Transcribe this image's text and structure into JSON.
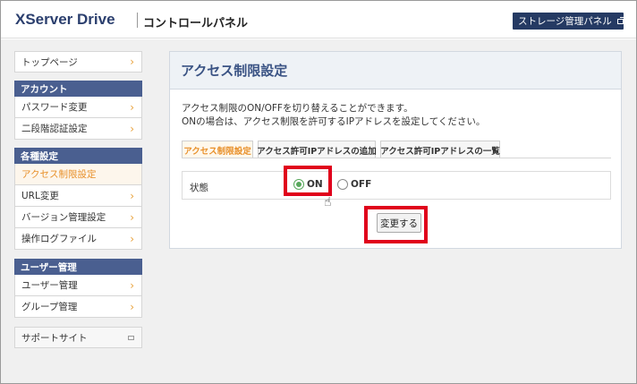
{
  "header": {
    "logo": "XServer Drive",
    "subtitle": "コントロールパネル",
    "storage_button": "ストレージ管理パネル"
  },
  "sidebar": {
    "top_item": "トップページ",
    "sections": [
      {
        "heading": "アカウント",
        "items": [
          "パスワード変更",
          "二段階認証設定"
        ]
      },
      {
        "heading": "各種設定",
        "items": [
          "アクセス制限設定",
          "URL変更",
          "バージョン管理設定",
          "操作ログファイル"
        ]
      },
      {
        "heading": "ユーザー管理",
        "items": [
          "ユーザー管理",
          "グループ管理"
        ]
      }
    ],
    "support": "サポートサイト",
    "active_item": "アクセス制限設定"
  },
  "main": {
    "title": "アクセス制限設定",
    "desc_line1": "アクセス制限のON/OFFを切り替えることができます。",
    "desc_line2": "ONの場合は、アクセス制限を許可するIPアドレスを設定してください。",
    "tabs": [
      "アクセス制限設定",
      "アクセス許可IPアドレスの追加",
      "アクセス許可IPアドレスの一覧"
    ],
    "status_label": "状態",
    "radio_on": "ON",
    "radio_off": "OFF",
    "selected": "ON",
    "submit": "変更する"
  },
  "colors": {
    "nav_heading": "#4a5f90",
    "accent_orange": "#e8902a",
    "highlight_red": "#e0001b",
    "header_button": "#253a63"
  }
}
